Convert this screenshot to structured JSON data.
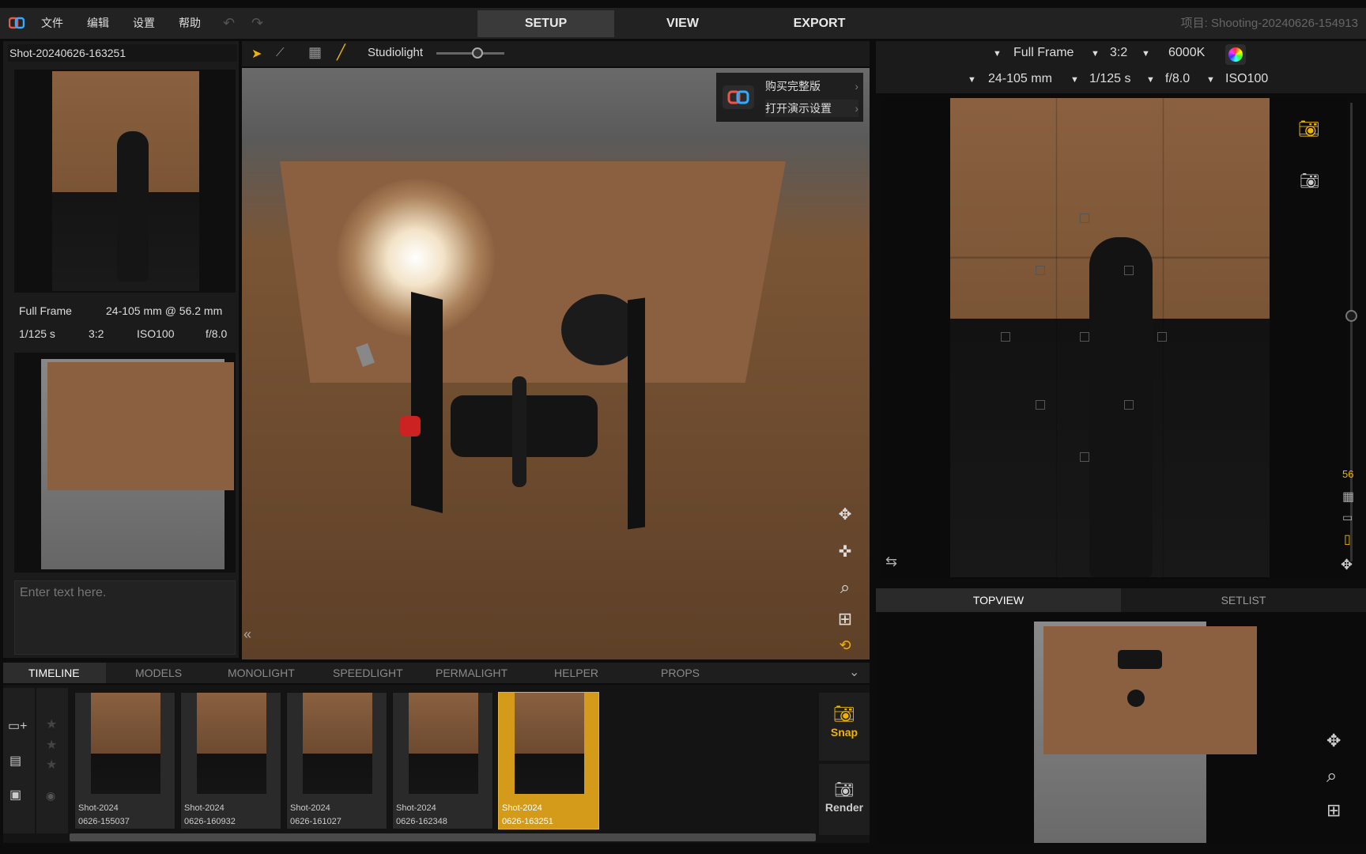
{
  "app": {
    "logo": "app-logo-icon",
    "menu": [
      "文件",
      "编辑",
      "设置",
      "帮助"
    ],
    "modes": [
      "SETUP",
      "VIEW",
      "EXPORT"
    ],
    "active_mode": "SETUP",
    "project_title": "项目: Shooting-20240626-154913"
  },
  "left": {
    "shot_name": "Shot-20240626-163251",
    "info": {
      "format": "Full Frame",
      "lens": "24-105 mm @ 56.2 mm",
      "shutter": "1/125 s",
      "ratio": "3:2",
      "iso": "ISO100",
      "aperture": "f/8.0"
    },
    "notes_placeholder": "Enter text here."
  },
  "viewport": {
    "toolbar_label": "Studiolight",
    "slider_value": 0.6,
    "promo": [
      "购买完整版",
      "打开演示设置"
    ]
  },
  "camera": {
    "format": "Full Frame",
    "ratio": "3:2",
    "kelvin": "6000K",
    "lens": "24-105 mm",
    "shutter": "1/125 s",
    "aperture": "f/8.0",
    "iso": "ISO100",
    "focal_readout": "56"
  },
  "bottom_tabs": [
    "TIMELINE",
    "MODELS",
    "MONOLIGHT",
    "SPEEDLIGHT",
    "PERMALIGHT",
    "HELPER",
    "PROPS"
  ],
  "timeline": [
    {
      "line1": "Shot-2024",
      "line2": "0626-155037"
    },
    {
      "line1": "Shot-2024",
      "line2": "0626-160932"
    },
    {
      "line1": "Shot-2024",
      "line2": "0626-161027"
    },
    {
      "line1": "Shot-2024",
      "line2": "0626-162348"
    },
    {
      "line1": "Shot-2024",
      "line2": "0626-163251"
    }
  ],
  "actions": {
    "snap": "Snap",
    "render": "Render"
  },
  "right_tabs": [
    "TOPVIEW",
    "SETLIST"
  ],
  "colors": {
    "accent": "#f0b400",
    "backdrop": "#8a6040",
    "selected": "#d49a1a"
  }
}
